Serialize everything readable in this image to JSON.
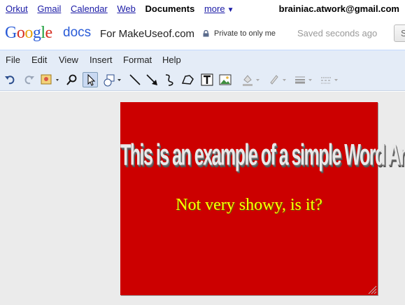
{
  "gbar": {
    "links": [
      {
        "label": "Orkut"
      },
      {
        "label": "Gmail"
      },
      {
        "label": "Calendar"
      },
      {
        "label": "Web"
      },
      {
        "label": "Documents"
      },
      {
        "label": "more"
      }
    ],
    "more_arrow": "▼",
    "email": "brainiac.atwork@gmail.com"
  },
  "header": {
    "logo_text": "Google",
    "docs_word": "docs",
    "doc_title": "For MakeUseof.com",
    "privacy": "Private to only me",
    "saved_status": "Saved seconds ago",
    "save_button": "Save"
  },
  "menubar": {
    "items": [
      {
        "label": "File"
      },
      {
        "label": "Edit"
      },
      {
        "label": "View"
      },
      {
        "label": "Insert"
      },
      {
        "label": "Format"
      },
      {
        "label": "Help"
      }
    ]
  },
  "toolbar": {
    "tools": [
      "undo-icon",
      "redo-icon",
      "image-insert-icon",
      "zoom-icon",
      "select-arrow-icon",
      "shape-icon",
      "line-icon",
      "arrow-line-icon",
      "curve-icon",
      "polyline-icon",
      "textbox-icon",
      "image-icon",
      "fill-color-icon",
      "line-color-icon",
      "line-weight-icon",
      "line-dash-icon"
    ],
    "selected_tool": "select-arrow-icon"
  },
  "drawing": {
    "background": "#cc0000",
    "wordart_text": "This is an example of a simple Word Art",
    "subtitle_text": "Not very showy, is it?",
    "subtitle_color": "#ffff00"
  },
  "colors": {
    "menubar_bg": "#e4ecf7",
    "canvas_bg": "#ebebeb",
    "link": "#1a1aa6"
  }
}
